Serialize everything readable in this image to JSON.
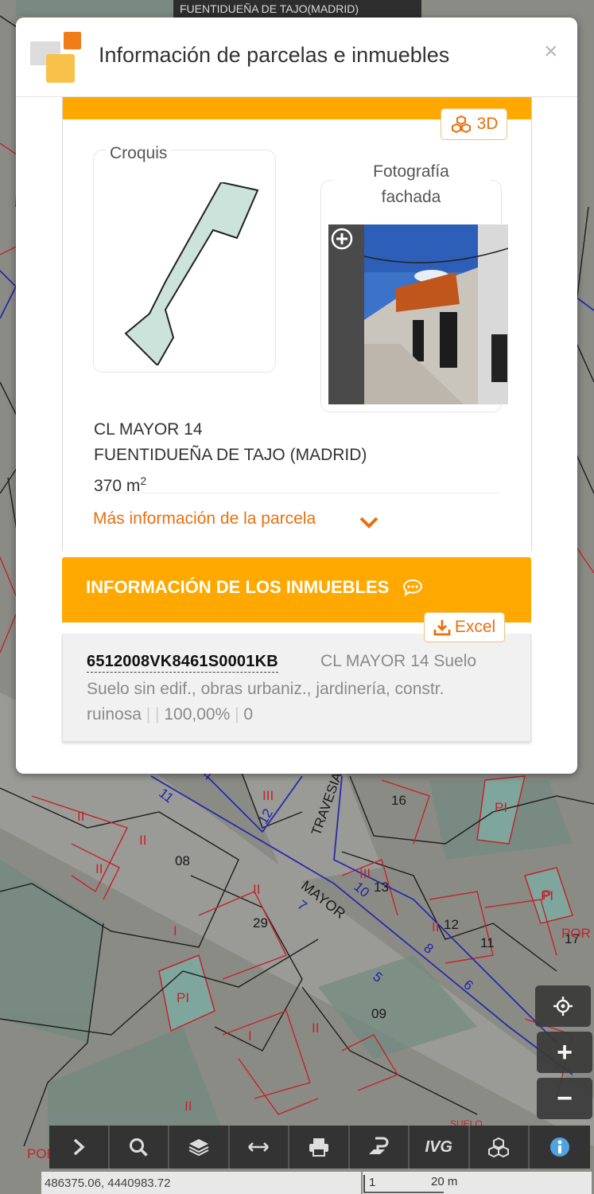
{
  "map": {
    "top_label": "FUENTIDUEÑA DE TAJO(MADRID)",
    "street_labels": [
      "MAYOR",
      "TRAVESIA"
    ],
    "parcel_numbers": [
      "16",
      "13",
      "12",
      "11",
      "17",
      "08",
      "29",
      "09",
      "10"
    ],
    "parcel_codes": [
      "II",
      "III",
      "I",
      "P",
      "PI",
      "POR",
      "SUELO"
    ],
    "street_numbers": [
      "11",
      "12",
      "10",
      "7",
      "8",
      "5",
      "6",
      "4"
    ],
    "colors": {
      "map_bg": "#8c8c86",
      "parcel_line": "#c2242b",
      "street_line": "#2222aa"
    }
  },
  "modal": {
    "title": "Información de parcelas e inmuebles",
    "close_symbol": "×",
    "btn_3d_label": "3D",
    "croquis_label": "Croquis",
    "facade_label_line1": "Fotografía",
    "facade_label_line2": "fachada",
    "address_line1": "CL MAYOR 14",
    "address_line2": "FUENTIDUEÑA DE TAJO (MADRID)",
    "area_value": "370 m",
    "area_unit_sup": "2",
    "more_info_label": "Más información de la parcela",
    "inmuebles_title": "INFORMACIÓN DE LOS INMUEBLES",
    "excel_label": "Excel",
    "inmueble": {
      "ref": "6512008VK8461S0001KB",
      "address": "CL MAYOR 14 Suelo",
      "desc_part1": "Suelo sin edif., obras urbaniz., jardinería, constr. ruinosa",
      "desc_part2": "",
      "desc_part3": "100,00%",
      "desc_part4": "0"
    },
    "colors": {
      "accent": "#fea800",
      "link": "#e8700e"
    }
  },
  "controls": {
    "locate": "crosshair-icon",
    "zoom_in": "+",
    "zoom_out": "−"
  },
  "toolbar": {
    "items": [
      "chevron-right-icon",
      "search-icon",
      "layers-icon",
      "measure-icon",
      "print-icon",
      "parcel-icon",
      "IVG",
      "cubes-icon",
      "info-icon"
    ],
    "ivg_label": "IVG"
  },
  "footer": {
    "coords": "486375.06, 4440983.72",
    "scale_label": "20 m",
    "scale_tick": "1"
  }
}
